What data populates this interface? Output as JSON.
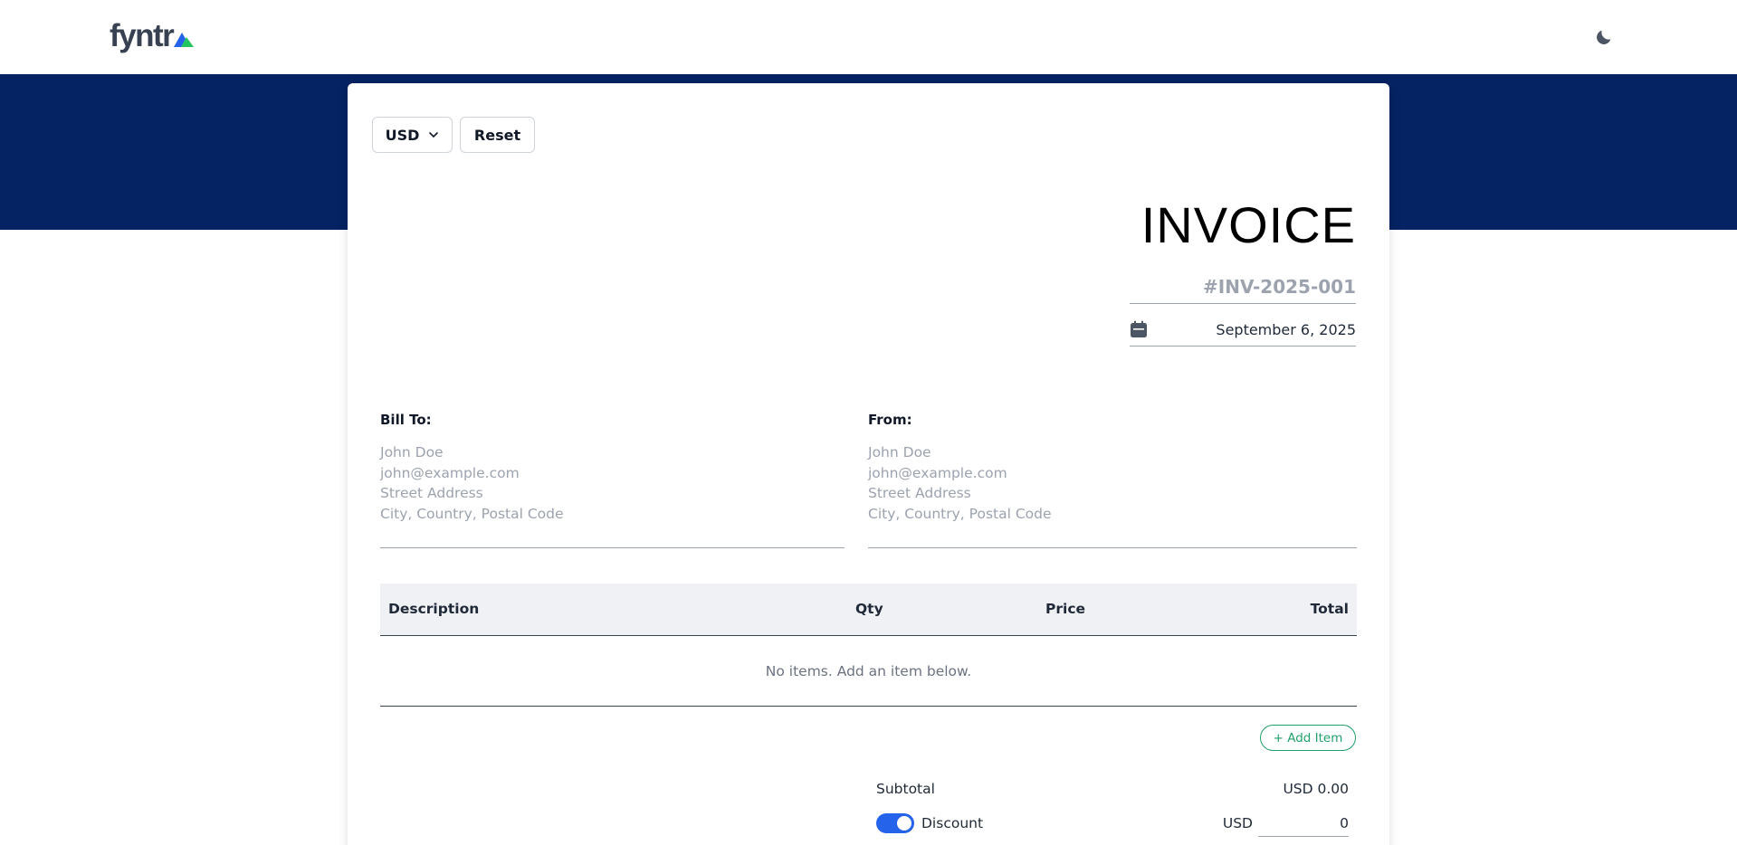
{
  "header": {
    "logo_text": "fyntr",
    "logo_mark_colors": [
      "#2563eb",
      "#22c55e"
    ],
    "theme_toggle_icon": "moon-icon"
  },
  "colors": {
    "band": "#052362",
    "accent_green": "#22a06b",
    "toggle_blue": "#2563eb"
  },
  "toolbar": {
    "currency_label": "USD",
    "currency_icon": "chevron-down-icon",
    "reset_label": "Reset"
  },
  "invoice": {
    "title": "INVOICE",
    "number_placeholder": "#INV-2025-001",
    "date": "September 6, 2025",
    "date_icon": "calendar-icon"
  },
  "bill_to": {
    "label": "Bill To:",
    "name_placeholder": "John Doe",
    "email_placeholder": "john@example.com",
    "street_placeholder": "Street Address",
    "city_placeholder": "City, Country, Postal Code"
  },
  "from": {
    "label": "From:",
    "name_placeholder": "John Doe",
    "email_placeholder": "john@example.com",
    "street_placeholder": "Street Address",
    "city_placeholder": "City, Country, Postal Code"
  },
  "items_table": {
    "columns": [
      "Description",
      "Qty",
      "Price",
      "Total"
    ],
    "empty_message": "No items. Add an item below.",
    "add_item_label": "+ Add Item"
  },
  "summary": {
    "subtotal_label": "Subtotal",
    "subtotal_value": "USD 0.00",
    "discount_label": "Discount",
    "discount_enabled": true,
    "discount_currency": "USD",
    "discount_value": "0"
  }
}
